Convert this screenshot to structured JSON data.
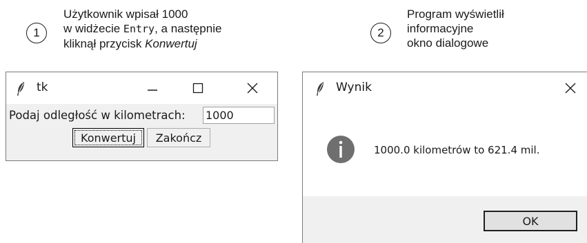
{
  "annotations": [
    {
      "number": "1",
      "line1": "Użytkownik wpisał 1000",
      "line2_pre": "w widżecie ",
      "line2_code": "Entry",
      "line2_post": ", a następnie",
      "line3_pre": "kliknął przycisk ",
      "line3_italic": "Konwertuj"
    },
    {
      "number": "2",
      "line1": "Program wyświetlił",
      "line2": "informacyjne",
      "line3": "okno dialogowe"
    }
  ],
  "main_window": {
    "title": "tk",
    "icon": "feather-icon",
    "controls": [
      "minimize-icon",
      "maximize-icon",
      "close-icon"
    ],
    "label": "Podaj odległość w kilometrach:",
    "entry_value": "1000",
    "buttons": {
      "convert": "Konwertuj",
      "quit": "Zakończ"
    }
  },
  "dialog": {
    "title": "Wynik",
    "icon": "feather-icon",
    "info_icon": "info-icon",
    "message": "1000.0 kilometrów to 621.4 mil.",
    "ok_label": "OK"
  },
  "colors": {
    "window_bg": "#f0f0f0",
    "border": "#7a7a7a",
    "info_icon": "#6f6f6f"
  }
}
